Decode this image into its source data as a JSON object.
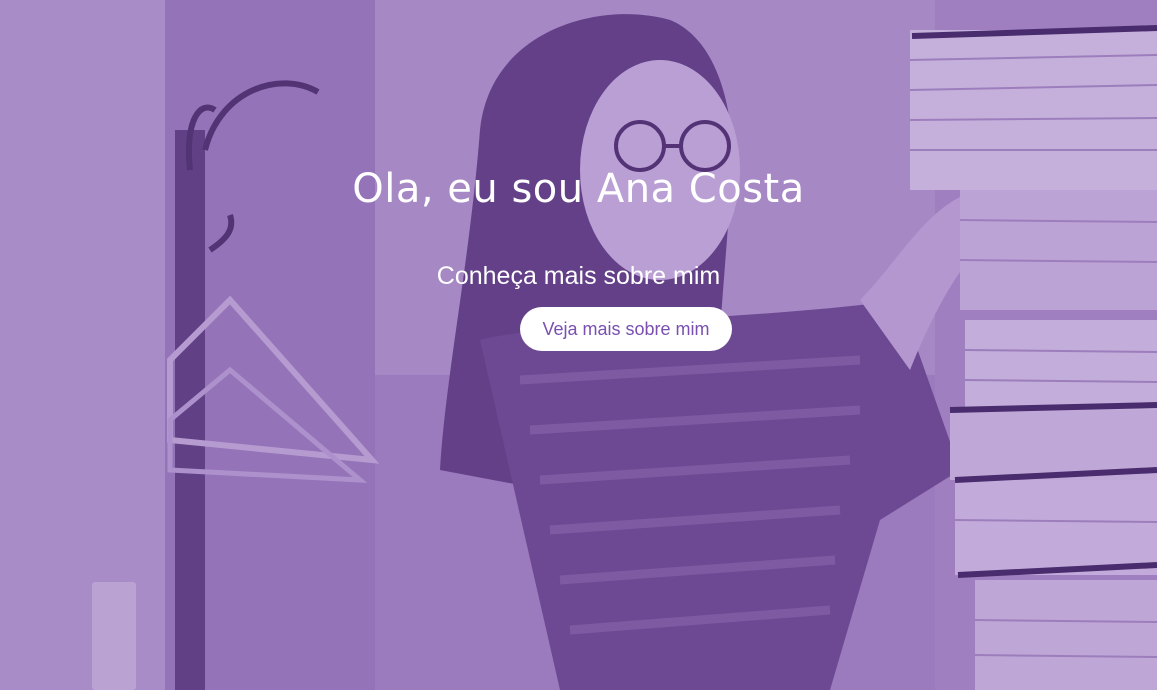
{
  "hero": {
    "title": "Ola, eu sou Ana Costa",
    "subtitle": "Conheça mais sobre mim",
    "cta_label": "Veja mais sobre mim"
  },
  "colors": {
    "overlay": "#a98cc6",
    "accent": "#7a4fb0",
    "text": "#ffffff"
  }
}
